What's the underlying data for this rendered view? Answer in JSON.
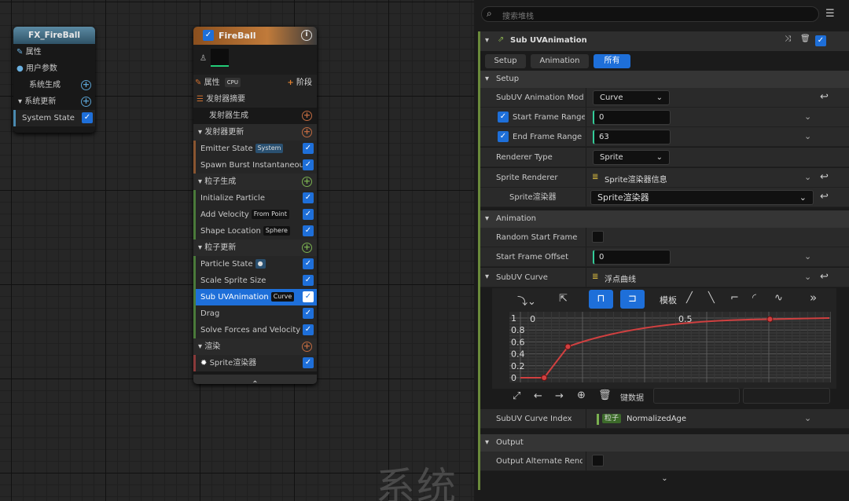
{
  "graph": {
    "watermark": "系统"
  },
  "system_node": {
    "title": "FX_FireBall",
    "props": "属性",
    "user_params": "用户参数",
    "spawn": "系统生成",
    "update": "系统更新",
    "state": "System State"
  },
  "emitter_node": {
    "title": "FireBall",
    "props": "属性",
    "cpu": "CPU",
    "stage": "阶段",
    "summary": "发射器摘要",
    "emit_spawn": "发射器生成",
    "emit_update": "发射器更新",
    "emitter_state": "Emitter State",
    "emitter_state_tag": "System",
    "spawn_burst": "Spawn Burst Instantaneous",
    "particle_spawn": "粒子生成",
    "init_particle": "Initialize Particle",
    "add_velocity": "Add Velocity",
    "add_velocity_tag": "From Point",
    "shape_location": "Shape Location",
    "shape_location_tag": "Sphere",
    "particle_update": "粒子更新",
    "particle_state": "Particle State",
    "scale_sprite": "Scale Sprite Size",
    "sub_uv": "Sub UVAnimation",
    "sub_uv_tag": "Curve",
    "drag": "Drag",
    "solve_forces": "Solve Forces and Velocity",
    "render": "渲染",
    "sprite_renderer": "Sprite渲染器"
  },
  "panel": {
    "search_placeholder": "搜索堆栈",
    "module_title": "Sub UVAnimation",
    "tabs": [
      "Setup",
      "Animation",
      "所有"
    ],
    "setup_cat": "Setup",
    "anim_mode_label": "SubUV Animation Mode",
    "anim_mode_value": "Curve",
    "start_frame_label": "Start Frame Range",
    "start_frame_value": "0",
    "end_frame_label": "End Frame Range C",
    "end_frame_value": "63",
    "renderer_type_label": "Renderer Type",
    "renderer_type_value": "Sprite",
    "sprite_renderer_label": "Sprite Renderer",
    "sprite_renderer_value": "Sprite渲染器信息",
    "sprite_sub_label": "Sprite渲染器",
    "sprite_sub_value": "Sprite渲染器",
    "anim_cat": "Animation",
    "random_start_label": "Random Start Frame",
    "start_offset_label": "Start Frame Offset",
    "start_offset_value": "0",
    "curve_label": "SubUV Curve",
    "curve_value": "浮点曲线",
    "template_label": "模板",
    "key_data_label": "键数据",
    "curve_index_label": "SubUV Curve Index",
    "curve_index_tag": "粒子",
    "curve_index_value": "NormalizedAge",
    "output_cat": "Output",
    "output_alt_label": "Output Alternate Render"
  },
  "chart_data": {
    "type": "line",
    "x_ticks": [
      "0",
      "0.5"
    ],
    "y_ticks": [
      "1",
      "0.8",
      "0.6",
      "0.4",
      "0.2",
      "0"
    ],
    "points": [
      {
        "x": 0,
        "y": 0
      },
      {
        "x": 0.04,
        "y": 0
      },
      {
        "x": 0.12,
        "y": 0.52
      },
      {
        "x": 0.8,
        "y": 0.98
      },
      {
        "x": 1.0,
        "y": 1.0
      }
    ],
    "xlim": [
      -0.04,
      1.0
    ],
    "ylim": [
      0,
      1
    ],
    "color": "#d04040"
  }
}
